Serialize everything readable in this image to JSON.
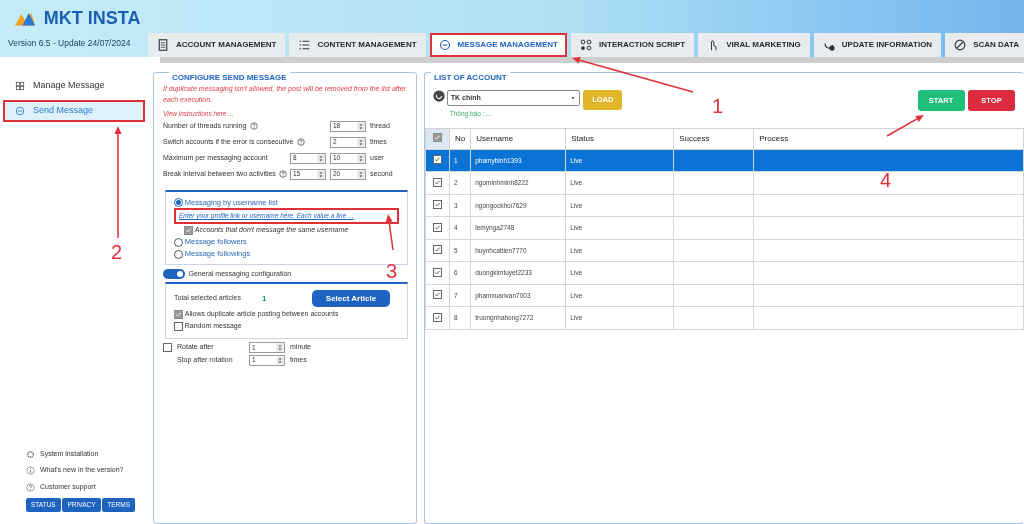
{
  "header": {
    "logo_text": "MKT INSTA",
    "version": "Version  6.5  - Update  24/07/2024"
  },
  "tabs": [
    {
      "label": "ACCOUNT MANAGEMENT",
      "selected": false,
      "highlighted": false
    },
    {
      "label": "CONTENT MANAGEMENT",
      "selected": false,
      "highlighted": false
    },
    {
      "label": "MESSAGE MANAGEMENT",
      "selected": true,
      "highlighted": true
    },
    {
      "label": "INTERACTION SCRIPT",
      "selected": false,
      "highlighted": false
    },
    {
      "label": "VIRAL MARKETING",
      "selected": false,
      "highlighted": false
    },
    {
      "label": "UPDATE INFORMATION",
      "selected": false,
      "highlighted": false
    },
    {
      "label": "SCAN DATA",
      "selected": false,
      "highlighted": false
    }
  ],
  "sidebar": {
    "items": [
      {
        "label": "Manage Message",
        "selected": false,
        "highlighted": false
      },
      {
        "label": "Send Message",
        "selected": true,
        "highlighted": true
      }
    ],
    "footer_links": [
      "System installation",
      "What's new in the version?",
      "Customer support"
    ],
    "footer_buttons": [
      "STATUS",
      "PRIVACY",
      "TERMS"
    ]
  },
  "config": {
    "title": "CONFIGURE SEND MESSAGE",
    "notice": "If duplicate messaging isn't allowed, the post will be removed from the list after each execution.",
    "instructions_link": "View instructions here ...",
    "settings": [
      {
        "label": "Number of threads running",
        "help": true,
        "values": [
          "18"
        ],
        "unit": "thread"
      },
      {
        "label": "Switch accounts if the error is consecutive",
        "help": true,
        "values": [
          "2"
        ],
        "unit": "times"
      },
      {
        "label": "Maximum per messaging account",
        "help": false,
        "values": [
          "8",
          "10"
        ],
        "unit": "user"
      },
      {
        "label": "Break interval between two activities",
        "help": true,
        "values": [
          "15",
          "20"
        ],
        "unit": "second"
      }
    ],
    "targets": [
      {
        "label": "Messaging by username list",
        "selected": true,
        "input_link": "Enter your profile link or username here. Each value a line ...",
        "input_highlighted": true,
        "option": {
          "label": "Accounts that don't message the same username",
          "checked": true
        }
      },
      {
        "label": "Message followers",
        "selected": false
      },
      {
        "label": "Message followings",
        "selected": false
      }
    ],
    "general_config": {
      "label": "General messaging configuration",
      "on": true
    },
    "articles": {
      "label": "Total selected articles",
      "count": "1",
      "button": "Select Article"
    },
    "article_options": [
      {
        "label": "Allows duplicate article posting between accounts",
        "checked": true
      },
      {
        "label": "Random message",
        "checked": false
      }
    ],
    "rotation": {
      "checked": false,
      "label": "Rotate after",
      "value": "1",
      "unit": "minute",
      "stop_label": "Stop after rotation",
      "stop_value": "1",
      "stop_unit": "times"
    }
  },
  "list": {
    "title": "LIST OF ACCOUNT",
    "account_select": "TK chính",
    "notice": "Thông báo : ...",
    "load_button": "LOAD",
    "start_button": "START",
    "stop_button": "STOP",
    "all_checked": true,
    "columns": [
      "No",
      "Username",
      "Status",
      "Success",
      "Process"
    ],
    "rows": [
      {
        "no": "1",
        "username": "phamybinh1393",
        "status": "Live",
        "checked": true,
        "selected": true
      },
      {
        "no": "2",
        "username": "ngominhminh8222",
        "status": "Live",
        "checked": true,
        "selected": false
      },
      {
        "no": "3",
        "username": "ngongockhoi7629",
        "status": "Live",
        "checked": true,
        "selected": false
      },
      {
        "no": "4",
        "username": "lemynga2748",
        "status": "Live",
        "checked": true,
        "selected": false
      },
      {
        "no": "5",
        "username": "huynhcattien7770",
        "status": "Live",
        "checked": true,
        "selected": false
      },
      {
        "no": "6",
        "username": "duongkimtuyet2233",
        "status": "Live",
        "checked": true,
        "selected": false
      },
      {
        "no": "7",
        "username": "phamxuanvan7003",
        "status": "Live",
        "checked": true,
        "selected": false
      },
      {
        "no": "8",
        "username": "truongnhahong7272",
        "status": "Live",
        "checked": true,
        "selected": false
      }
    ]
  },
  "annotations": [
    {
      "label": "1"
    },
    {
      "label": "2"
    },
    {
      "label": "3"
    },
    {
      "label": "4"
    }
  ]
}
